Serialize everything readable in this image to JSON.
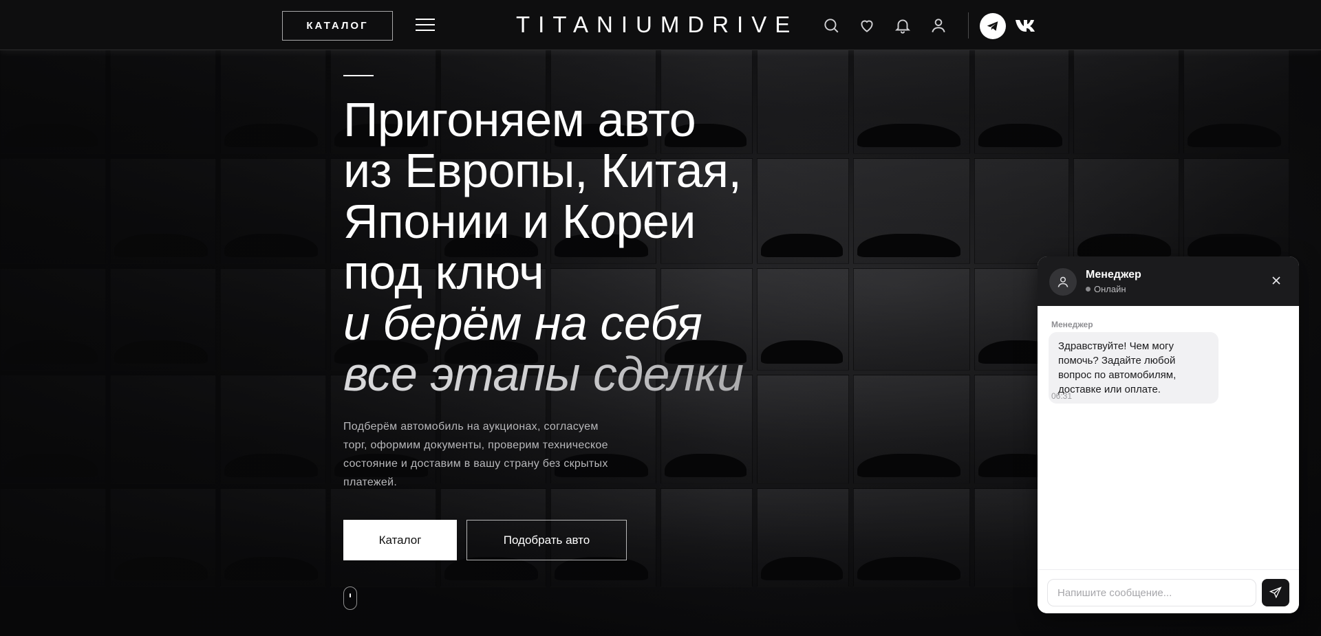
{
  "header": {
    "catalog_label": "КАТАЛОГ",
    "logo": "TITANIUMDRIVE",
    "icons": [
      "search-icon",
      "heart-icon",
      "bell-icon",
      "user-icon",
      "telegram-icon",
      "vk-icon"
    ]
  },
  "hero": {
    "title_lines": [
      "Пригоняем авто",
      "из Европы, Китая,",
      "Японии и Кореи",
      "под ключ"
    ],
    "italic_lines": [
      "и берём на себя",
      "все этапы сделки"
    ],
    "subtitle": "Подберём автомобиль на аукционах, согласуем торг, оформим документы, проверим техническое состояние и доставим в вашу страну без скрытых платежей.",
    "primary_button": "Каталог",
    "secondary_button": "Подобрать авто"
  },
  "chat": {
    "manager_name": "Менеджер",
    "status": "Онлайн",
    "message_author": "Менеджер",
    "message_text": "Здравствуйте! Чем могу помочь? Задайте любой вопрос по автомобилям, доставке или оплате.",
    "message_time": "06:31",
    "input_placeholder": "Напишите сообщение..."
  },
  "colors": {
    "background": "#0b0b0c",
    "header": "#0e0e0f",
    "accent": "#ffffff",
    "chat_header": "#1b1b1d"
  }
}
